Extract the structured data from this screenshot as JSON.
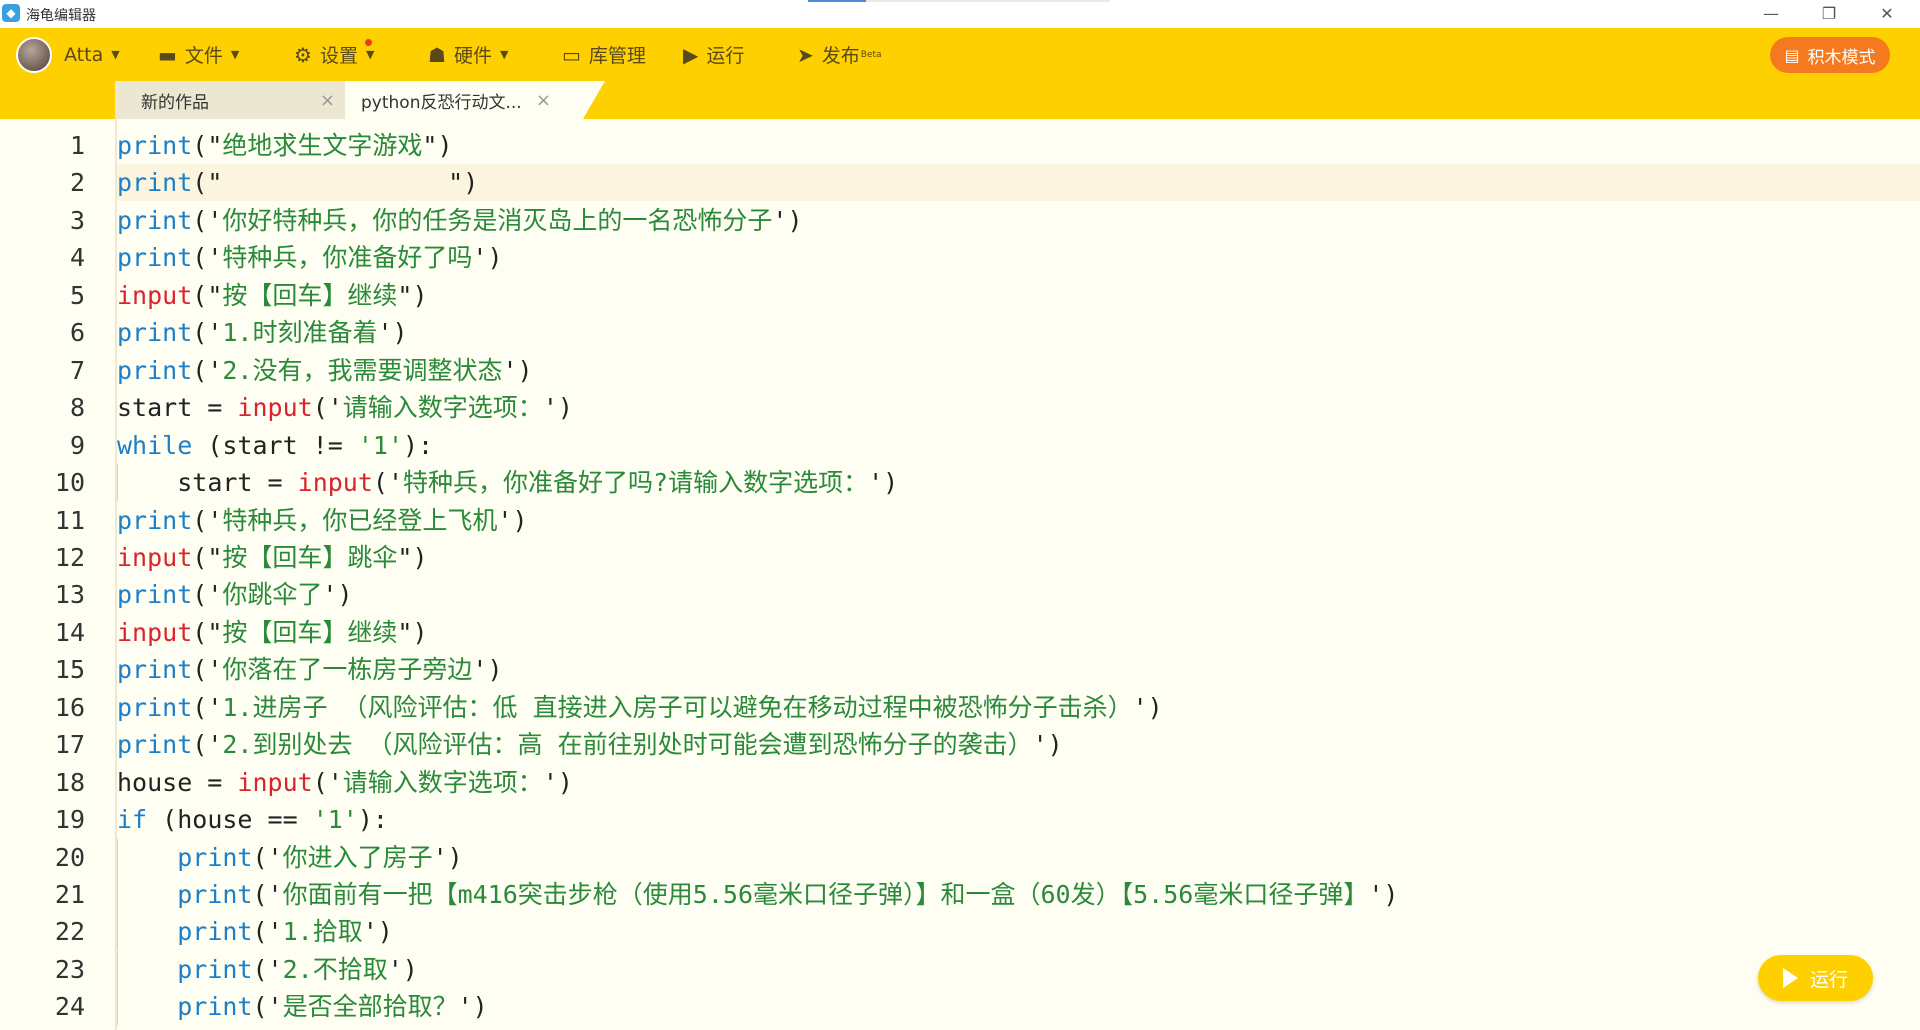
{
  "window": {
    "title": "海龟编辑器",
    "controls": {
      "minimize": "—",
      "restore": "❐",
      "close": "✕"
    }
  },
  "toolbar": {
    "user": "Atta",
    "file": "文件",
    "settings": "设置",
    "hardware": "硬件",
    "library": "库管理",
    "run": "运行",
    "publish": "发布",
    "publish_badge": "Beta",
    "block_mode": "积木模式"
  },
  "tabs": [
    {
      "label": "新的作品",
      "close": "×"
    },
    {
      "label": "python反恐行动文...",
      "close": "×"
    }
  ],
  "editor": {
    "lines": [
      {
        "n": "1",
        "indent": "",
        "parts": [
          {
            "t": "print",
            "c": "kw-print"
          },
          {
            "t": "(\"",
            "c": "plain"
          },
          {
            "t": "绝地求生文字游戏",
            "c": "str"
          },
          {
            "t": "\")",
            "c": "plain"
          }
        ]
      },
      {
        "n": "2",
        "indent": "",
        "parts": [
          {
            "t": "print",
            "c": "kw-print"
          },
          {
            "t": "(\"",
            "c": "plain"
          },
          {
            "t": "               ",
            "c": "str"
          },
          {
            "t": "\")",
            "c": "plain"
          }
        ]
      },
      {
        "n": "3",
        "indent": "",
        "parts": [
          {
            "t": "print",
            "c": "kw-print"
          },
          {
            "t": "('",
            "c": "plain"
          },
          {
            "t": "你好特种兵，你的任务是消灭岛上的一名恐怖分子",
            "c": "str"
          },
          {
            "t": "')",
            "c": "plain"
          }
        ]
      },
      {
        "n": "4",
        "indent": "",
        "parts": [
          {
            "t": "print",
            "c": "kw-print"
          },
          {
            "t": "('",
            "c": "plain"
          },
          {
            "t": "特种兵，你准备好了吗",
            "c": "str"
          },
          {
            "t": "')",
            "c": "plain"
          }
        ]
      },
      {
        "n": "5",
        "indent": "",
        "parts": [
          {
            "t": "input",
            "c": "kw-input"
          },
          {
            "t": "(\"",
            "c": "plain"
          },
          {
            "t": "按【回车】继续",
            "c": "str"
          },
          {
            "t": "\")",
            "c": "plain"
          }
        ]
      },
      {
        "n": "6",
        "indent": "",
        "parts": [
          {
            "t": "print",
            "c": "kw-print"
          },
          {
            "t": "('",
            "c": "plain"
          },
          {
            "t": "1.时刻准备着",
            "c": "str"
          },
          {
            "t": "')",
            "c": "plain"
          }
        ]
      },
      {
        "n": "7",
        "indent": "",
        "parts": [
          {
            "t": "print",
            "c": "kw-print"
          },
          {
            "t": "('",
            "c": "plain"
          },
          {
            "t": "2.没有，我需要调整状态",
            "c": "str"
          },
          {
            "t": "')",
            "c": "plain"
          }
        ]
      },
      {
        "n": "8",
        "indent": "",
        "parts": [
          {
            "t": "start = ",
            "c": "plain"
          },
          {
            "t": "input",
            "c": "kw-input"
          },
          {
            "t": "('",
            "c": "plain"
          },
          {
            "t": "请输入数字选项：",
            "c": "str"
          },
          {
            "t": "')",
            "c": "plain"
          }
        ]
      },
      {
        "n": "9",
        "indent": "",
        "parts": [
          {
            "t": "while",
            "c": "kw-while"
          },
          {
            "t": " (start != ",
            "c": "plain"
          },
          {
            "t": "'1'",
            "c": "str"
          },
          {
            "t": "):",
            "c": "plain"
          }
        ]
      },
      {
        "n": "10",
        "indent": "    ",
        "parts": [
          {
            "t": "start = ",
            "c": "plain"
          },
          {
            "t": "input",
            "c": "kw-input"
          },
          {
            "t": "('",
            "c": "plain"
          },
          {
            "t": "特种兵，你准备好了吗?请输入数字选项：",
            "c": "str"
          },
          {
            "t": "')",
            "c": "plain"
          }
        ]
      },
      {
        "n": "11",
        "indent": "",
        "parts": [
          {
            "t": "print",
            "c": "kw-print"
          },
          {
            "t": "('",
            "c": "plain"
          },
          {
            "t": "特种兵，你已经登上飞机",
            "c": "str"
          },
          {
            "t": "')",
            "c": "plain"
          }
        ]
      },
      {
        "n": "12",
        "indent": "",
        "parts": [
          {
            "t": "input",
            "c": "kw-input"
          },
          {
            "t": "(\"",
            "c": "plain"
          },
          {
            "t": "按【回车】跳伞",
            "c": "str"
          },
          {
            "t": "\")",
            "c": "plain"
          }
        ]
      },
      {
        "n": "13",
        "indent": "",
        "parts": [
          {
            "t": "print",
            "c": "kw-print"
          },
          {
            "t": "('",
            "c": "plain"
          },
          {
            "t": "你跳伞了",
            "c": "str"
          },
          {
            "t": "')",
            "c": "plain"
          }
        ]
      },
      {
        "n": "14",
        "indent": "",
        "parts": [
          {
            "t": "input",
            "c": "kw-input"
          },
          {
            "t": "(\"",
            "c": "plain"
          },
          {
            "t": "按【回车】继续",
            "c": "str"
          },
          {
            "t": "\")",
            "c": "plain"
          }
        ]
      },
      {
        "n": "15",
        "indent": "",
        "parts": [
          {
            "t": "print",
            "c": "kw-print"
          },
          {
            "t": "('",
            "c": "plain"
          },
          {
            "t": "你落在了一栋房子旁边",
            "c": "str"
          },
          {
            "t": "')",
            "c": "plain"
          }
        ]
      },
      {
        "n": "16",
        "indent": "",
        "parts": [
          {
            "t": "print",
            "c": "kw-print"
          },
          {
            "t": "('",
            "c": "plain"
          },
          {
            "t": "1.进房子 （风险评估：低 直接进入房子可以避免在移动过程中被恐怖分子击杀）",
            "c": "str"
          },
          {
            "t": "')",
            "c": "plain"
          }
        ]
      },
      {
        "n": "17",
        "indent": "",
        "parts": [
          {
            "t": "print",
            "c": "kw-print"
          },
          {
            "t": "('",
            "c": "plain"
          },
          {
            "t": "2.到别处去 （风险评估：高 在前往别处时可能会遭到恐怖分子的袭击）",
            "c": "str"
          },
          {
            "t": "')",
            "c": "plain"
          }
        ]
      },
      {
        "n": "18",
        "indent": "",
        "parts": [
          {
            "t": "house = ",
            "c": "plain"
          },
          {
            "t": "input",
            "c": "kw-input"
          },
          {
            "t": "('",
            "c": "plain"
          },
          {
            "t": "请输入数字选项：",
            "c": "str"
          },
          {
            "t": "')",
            "c": "plain"
          }
        ]
      },
      {
        "n": "19",
        "indent": "",
        "parts": [
          {
            "t": "if",
            "c": "kw-while"
          },
          {
            "t": " (house == ",
            "c": "plain"
          },
          {
            "t": "'1'",
            "c": "str"
          },
          {
            "t": "):",
            "c": "plain"
          }
        ]
      },
      {
        "n": "20",
        "indent": "    ",
        "parts": [
          {
            "t": "print",
            "c": "kw-print"
          },
          {
            "t": "('",
            "c": "plain"
          },
          {
            "t": "你进入了房子",
            "c": "str"
          },
          {
            "t": "')",
            "c": "plain"
          }
        ]
      },
      {
        "n": "21",
        "indent": "    ",
        "parts": [
          {
            "t": "print",
            "c": "kw-print"
          },
          {
            "t": "('",
            "c": "plain"
          },
          {
            "t": "你面前有一把【m416突击步枪（使用5.56毫米口径子弹）】和一盒（60发）【5.56毫米口径子弹】",
            "c": "str"
          },
          {
            "t": "')",
            "c": "plain"
          }
        ]
      },
      {
        "n": "22",
        "indent": "    ",
        "parts": [
          {
            "t": "print",
            "c": "kw-print"
          },
          {
            "t": "('",
            "c": "plain"
          },
          {
            "t": "1.拾取",
            "c": "str"
          },
          {
            "t": "')",
            "c": "plain"
          }
        ]
      },
      {
        "n": "23",
        "indent": "    ",
        "parts": [
          {
            "t": "print",
            "c": "kw-print"
          },
          {
            "t": "('",
            "c": "plain"
          },
          {
            "t": "2.不拾取",
            "c": "str"
          },
          {
            "t": "')",
            "c": "plain"
          }
        ]
      },
      {
        "n": "24",
        "indent": "    ",
        "parts": [
          {
            "t": "print",
            "c": "kw-print"
          },
          {
            "t": "('",
            "c": "plain"
          },
          {
            "t": "是否全部拾取？",
            "c": "str"
          },
          {
            "t": "')",
            "c": "plain"
          }
        ]
      }
    ]
  },
  "run_button": {
    "label": "运行"
  },
  "colors": {
    "toolbar": "#ffd000",
    "accent_orange": "#f57a1f",
    "editor_bg": "#fffef3",
    "keyword": "#1c7fc7",
    "builtin_input": "#d8242c",
    "string": "#2a8a3a"
  },
  "icons": {
    "app": "turtle-logo-icon",
    "file": "folder-icon",
    "settings": "gear-icon",
    "hardware": "robot-icon",
    "library": "box-icon",
    "run": "play-circle-icon",
    "publish": "paper-plane-icon",
    "block_mode": "blocks-icon"
  }
}
